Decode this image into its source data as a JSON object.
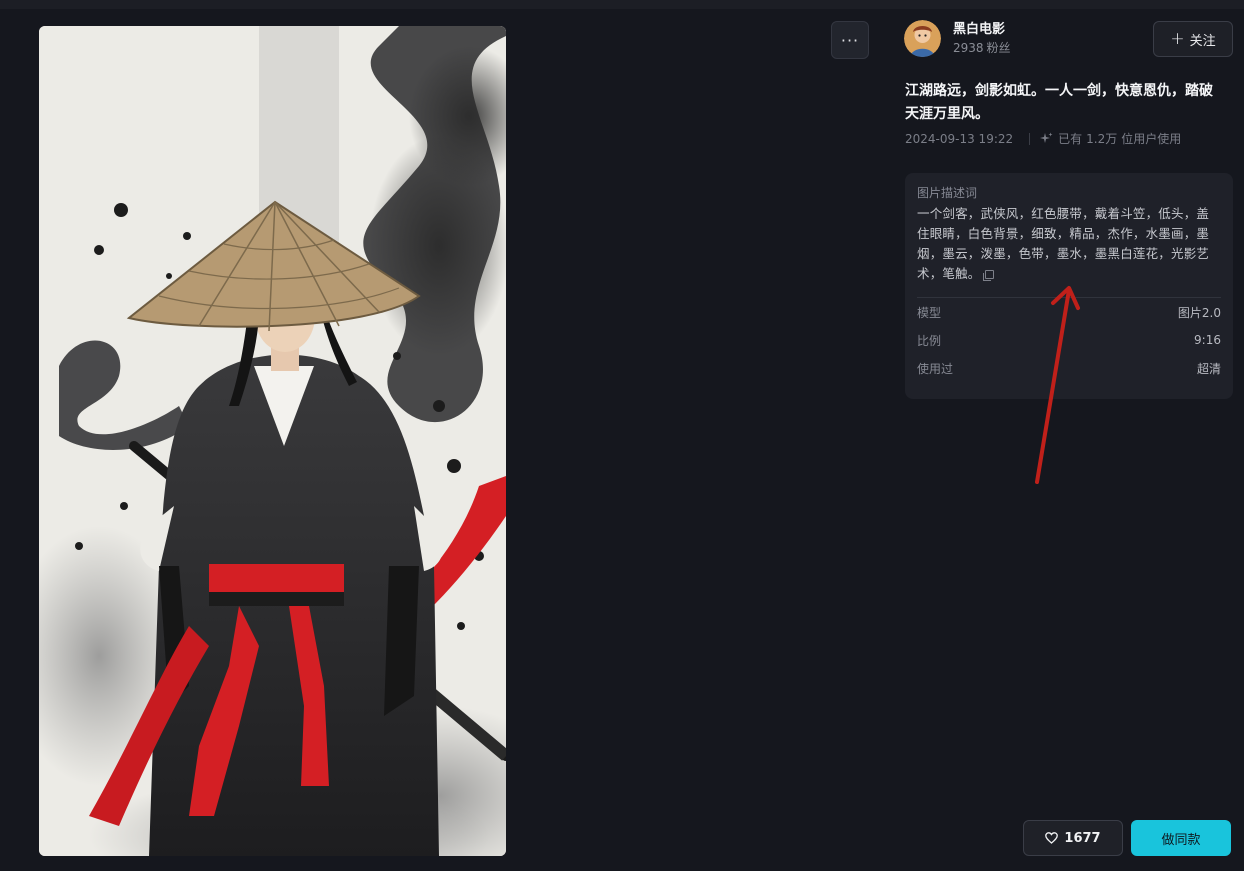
{
  "toolbar": {
    "more_label": "···"
  },
  "author": {
    "name": "黑白电影",
    "fans_count": "2938",
    "fans_label": "粉丝"
  },
  "follow": {
    "label": "关注",
    "icon": "plus-icon"
  },
  "post": {
    "title": "江湖路远，剑影如虹。一人一剑，快意恩仇，踏破天涯万里风。",
    "timestamp": "2024-09-13 19:22",
    "usage_prefix": "已有",
    "usage_count": "1.2万",
    "usage_suffix": "位用户使用"
  },
  "prompt_card": {
    "label": "图片描述词",
    "text": "一个剑客，武侠风，红色腰带，戴着斗笠，低头，盖住眼睛，白色背景，细致，精品，杰作，水墨画，墨烟，墨云，泼墨，色带，墨水，墨黑白莲花，光影艺术，笔触。",
    "params": [
      {
        "key": "模型",
        "value": "图片2.0"
      },
      {
        "key": "比例",
        "value": "9:16"
      },
      {
        "key": "使用过",
        "value": "超清"
      }
    ]
  },
  "actions": {
    "like_count": "1677",
    "make_label": "做同款"
  },
  "colors": {
    "accent": "#19c4dc",
    "background": "#15171e",
    "annotation": "#c0201a",
    "sash": "#d41f24"
  }
}
